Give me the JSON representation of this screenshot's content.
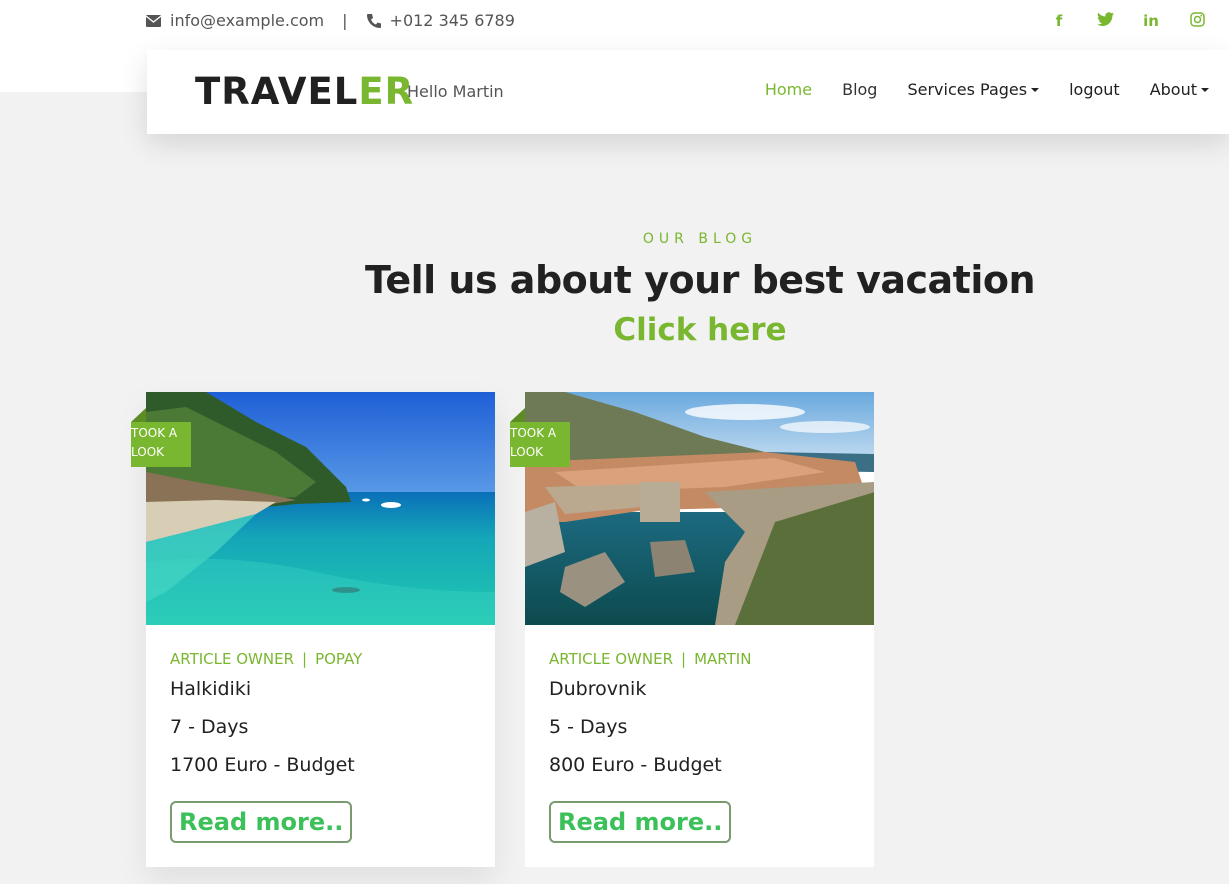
{
  "topbar": {
    "email": "info@example.com",
    "separator": "|",
    "phone": "+012 345 6789",
    "social_icons": [
      "facebook-icon",
      "twitter-icon",
      "linkedin-icon",
      "instagram-icon"
    ],
    "social_glyphs": [
      "f",
      "t",
      "in",
      "◎"
    ]
  },
  "navbar": {
    "brand_main": "TRAVEL",
    "brand_accent": "ER",
    "greeting": "Hello Martin",
    "links": {
      "home": "Home",
      "blog": "Blog",
      "services": "Services Pages",
      "logout": "logout",
      "about": "About"
    }
  },
  "section": {
    "kicker": "OUR BLOG",
    "headline": "Tell us about your best vacation",
    "cta": "Click here"
  },
  "cards": [
    {
      "ribbon": "TOOK A LOOK",
      "meta_label": "ARTICLE OWNER",
      "meta_sep": "|",
      "owner": "POPAY",
      "place": "Halkidiki",
      "days": "7 - Days",
      "budget": "1700 Euro - Budget",
      "read_more": "Read more.."
    },
    {
      "ribbon": "TOOK A LOOK",
      "meta_label": "ARTICLE OWNER",
      "meta_sep": "|",
      "owner": "MARTIN",
      "place": "Dubrovnik",
      "days": "5 - Days",
      "budget": "800 Euro - Budget",
      "read_more": "Read more.."
    }
  ],
  "colors": {
    "accent": "#7ab730",
    "button_text": "#3cc15a",
    "dark_text": "#212121",
    "page_bg": "#f2f2f2"
  }
}
